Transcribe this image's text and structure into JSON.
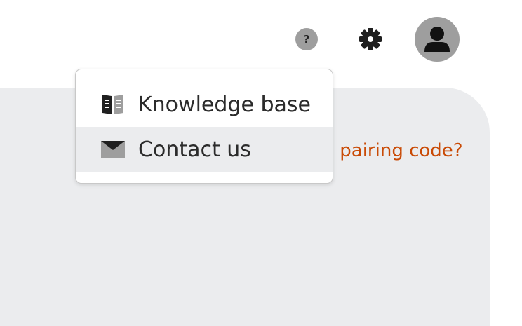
{
  "header": {
    "help_label": "?",
    "icons": [
      "help-icon",
      "gear-icon",
      "user-avatar-icon"
    ]
  },
  "main": {
    "pairing_link_text": "Don't have a pairing code?"
  },
  "help_menu": {
    "items": [
      {
        "label": "Knowledge base",
        "icon": "book-icon"
      },
      {
        "label": "Contact us",
        "icon": "envelope-icon"
      }
    ]
  },
  "colors": {
    "accent": "#c94a05",
    "panel_background": "#ebecee",
    "icon_gray": "#9e9e9e",
    "hover_background": "#ebecee"
  }
}
